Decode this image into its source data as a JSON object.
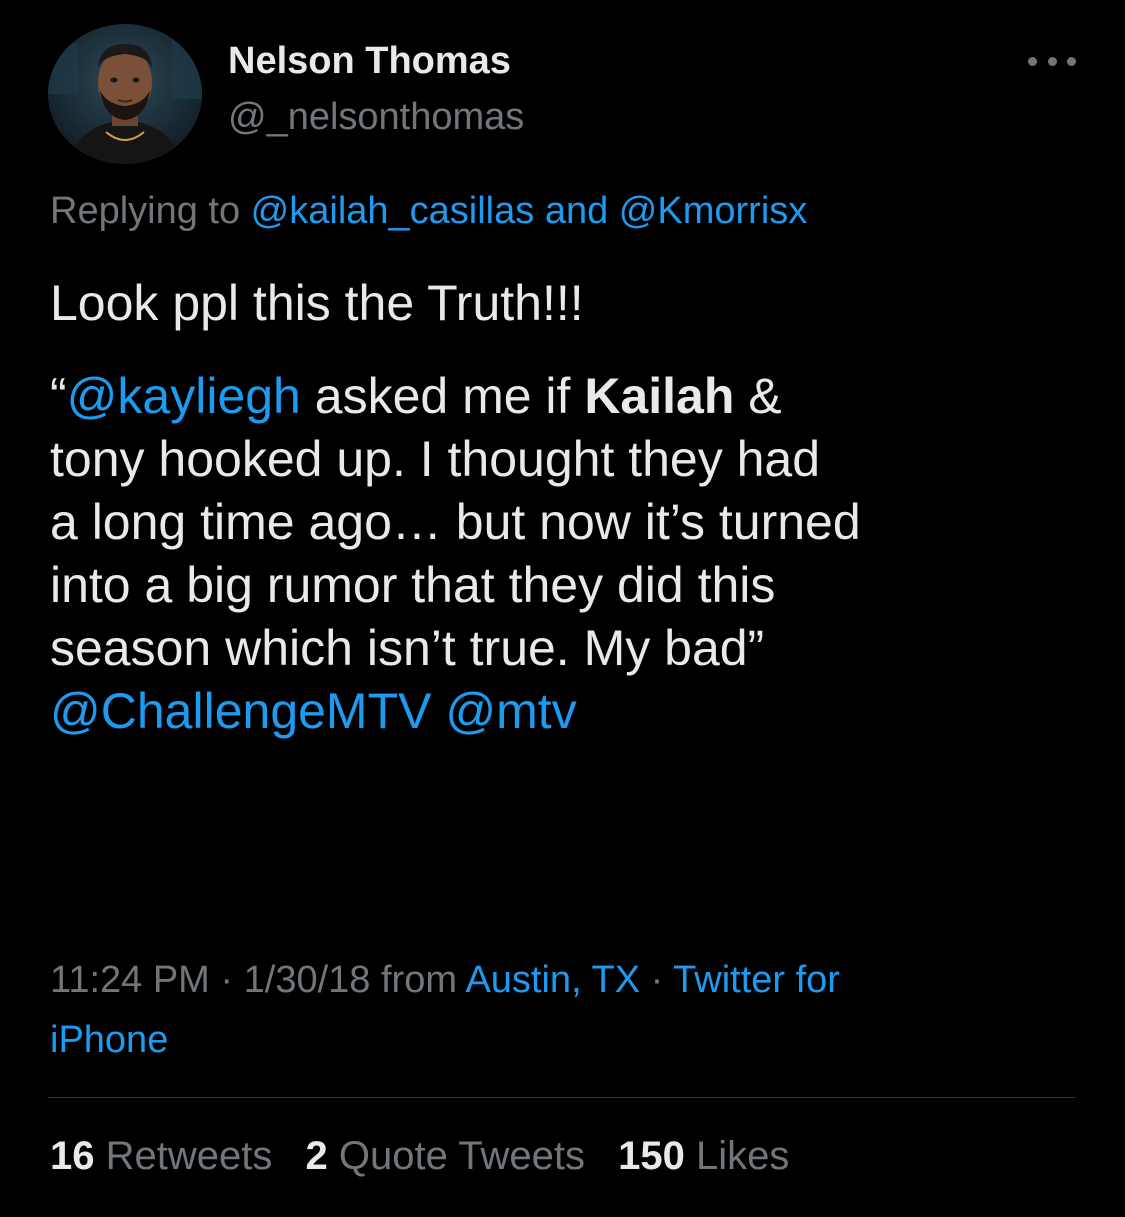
{
  "author": {
    "display_name": "Nelson Thomas",
    "handle": "@_nelsonthomas",
    "avatar_icon": "profile-photo"
  },
  "reply": {
    "prefix": "Replying to ",
    "mention_1": "@kailah_casillas",
    "conjunction": " and ",
    "mention_2": "@Kmorrisx"
  },
  "body": {
    "line_1": "Look ppl this the Truth!!!",
    "quote_open": " “",
    "mention_kayliegh": "@kayliegh",
    "q_text_1": " asked me if ",
    "q_bold": "Kailah",
    "q_text_2": " &",
    "q_line_2": "tony hooked up. I thought they had",
    "q_line_3": "a long time ago… but now it’s turned",
    "q_line_4": "into a big rumor that they did this",
    "q_line_5": "season which isn’t true. My bad”",
    "mention_challenge": "@ChallengeMTV",
    "mention_mtv": "@mtv"
  },
  "meta": {
    "time": "11:24 PM",
    "sep": " · ",
    "date": "1/30/18",
    "from": " from ",
    "location": "Austin, TX",
    "source_line1": "Twitter for",
    "source_line2": "iPhone"
  },
  "stats": {
    "retweets_count": "16",
    "retweets_label": "Retweets",
    "quotes_count": "2",
    "quotes_label": "Quote Tweets",
    "likes_count": "150",
    "likes_label": "Likes"
  },
  "colors": {
    "background": "#000000",
    "text": "#e7e9ea",
    "secondary": "#71767b",
    "link": "#1d9bf0"
  }
}
